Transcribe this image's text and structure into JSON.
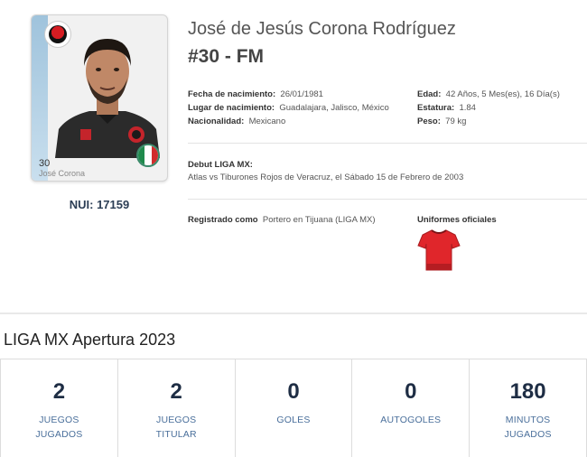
{
  "card": {
    "number": "30",
    "name": "José Corona",
    "club_badge_icon": "xolos-club-badge-icon",
    "flag_icon": "mexico-flag-icon"
  },
  "nui": "NUI: 17159",
  "player": {
    "full_name": "José de Jesús Corona Rodríguez",
    "number_position": "#30 - FM"
  },
  "details_left": [
    {
      "label": "Fecha de nacimiento:",
      "value": "26/01/1981"
    },
    {
      "label": "Lugar de nacimiento:",
      "value": "Guadalajara, Jalisco, México"
    },
    {
      "label": "Nacionalidad:",
      "value": "Mexicano"
    }
  ],
  "details_right": [
    {
      "label": "Edad:",
      "value": "42 Años, 5 Mes(es), 16 Día(s)"
    },
    {
      "label": "Estatura:",
      "value": "1.84"
    },
    {
      "label": "Peso:",
      "value": "79 kg"
    }
  ],
  "debut": {
    "label": "Debut LIGA MX:",
    "text": "Atlas vs Tiburones Rojos de Veracruz, el Sábado 15 de Febrero de 2003"
  },
  "registered": {
    "label": "Registrado como",
    "value": "Portero en Tijuana (LIGA MX)"
  },
  "uniforms": {
    "label": "Uniformes oficiales",
    "shirt_icon": "red-jersey-icon"
  },
  "season": {
    "title": "LIGA MX Apertura 2023"
  },
  "stats": [
    {
      "value": "2",
      "label_line1": "JUEGOS",
      "label_line2": "JUGADOS"
    },
    {
      "value": "2",
      "label_line1": "JUEGOS",
      "label_line2": "TITULAR"
    },
    {
      "value": "0",
      "label_line1": "GOLES",
      "label_line2": ""
    },
    {
      "value": "0",
      "label_line1": "AUTOGOLES",
      "label_line2": ""
    },
    {
      "value": "180",
      "label_line1": "MINUTOS",
      "label_line2": "JUGADOS"
    }
  ],
  "colors": {
    "stat_value": "#1e2d44",
    "stat_label": "#4a6f9b",
    "club_red": "#d51c22"
  }
}
